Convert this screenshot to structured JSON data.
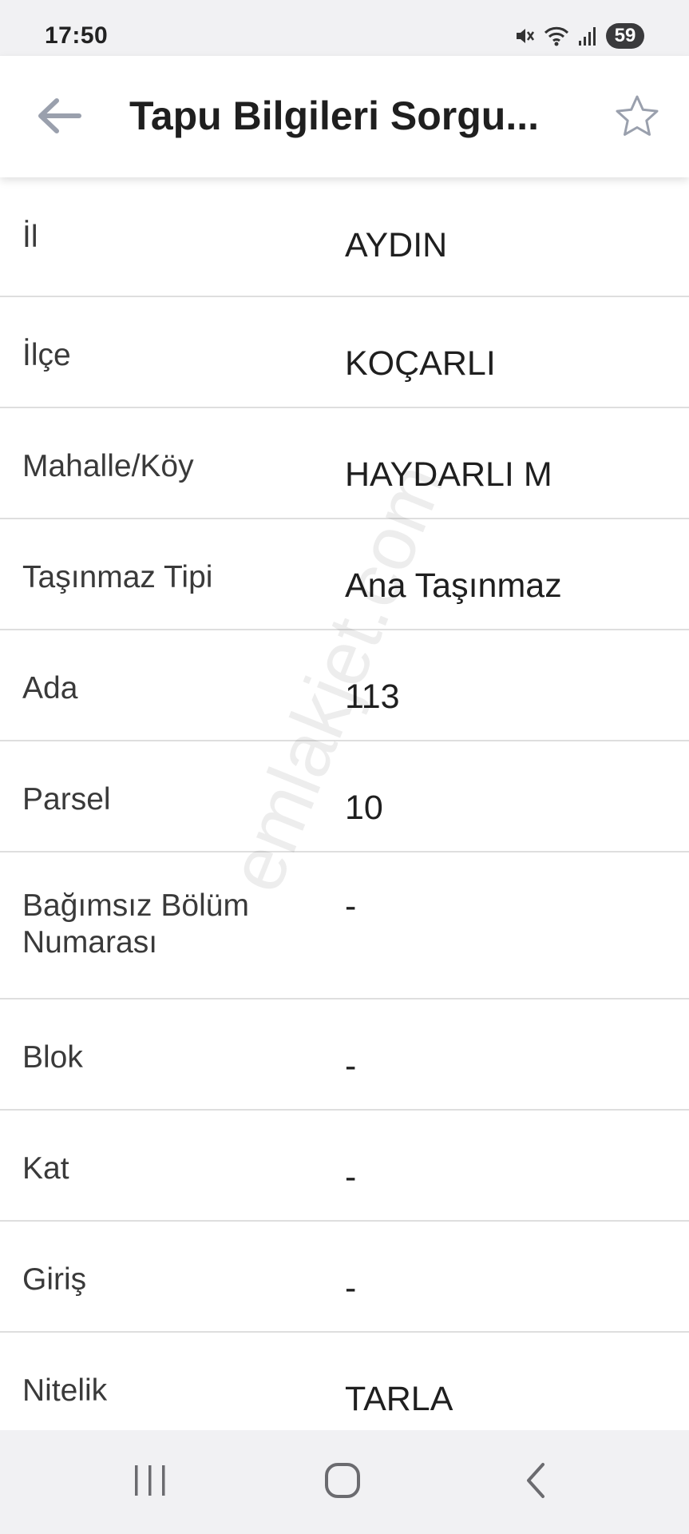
{
  "status_bar": {
    "time": "17:50",
    "battery": "59",
    "icons": [
      "mute-icon",
      "wifi-icon",
      "signal-icon"
    ]
  },
  "app_bar": {
    "title": "Tapu Bilgileri Sorgu...",
    "back_icon": "arrow-left-icon",
    "favorite_icon": "star-outline-icon"
  },
  "rows": [
    {
      "label": "İl",
      "value": "AYDIN"
    },
    {
      "label": "İlçe",
      "value": "KOÇARLI"
    },
    {
      "label": "Mahalle/Köy",
      "value": "HAYDARLI M"
    },
    {
      "label": "Taşınmaz Tipi",
      "value": "Ana Taşınmaz"
    },
    {
      "label": "Ada",
      "value": "113"
    },
    {
      "label": "Parsel",
      "value": "10"
    },
    {
      "label": "Bağımsız Bölüm Numarası",
      "value": "-"
    },
    {
      "label": "Blok",
      "value": "-"
    },
    {
      "label": "Kat",
      "value": "-"
    },
    {
      "label": "Giriş",
      "value": "-"
    },
    {
      "label": "Nitelik",
      "value": "TARLA"
    }
  ],
  "watermark": "emlakjet.com",
  "nav_bar": {
    "recents_icon": "recent-apps-icon",
    "home_icon": "home-icon",
    "back_icon": "nav-back-icon"
  },
  "colors": {
    "status_bg": "#f1f1f3",
    "app_bar_bg": "#ffffff",
    "divider": "#dedede",
    "text_primary": "#1f1f1f",
    "text_label": "#3a3a3a",
    "icon_gray": "#9aa0ad"
  }
}
